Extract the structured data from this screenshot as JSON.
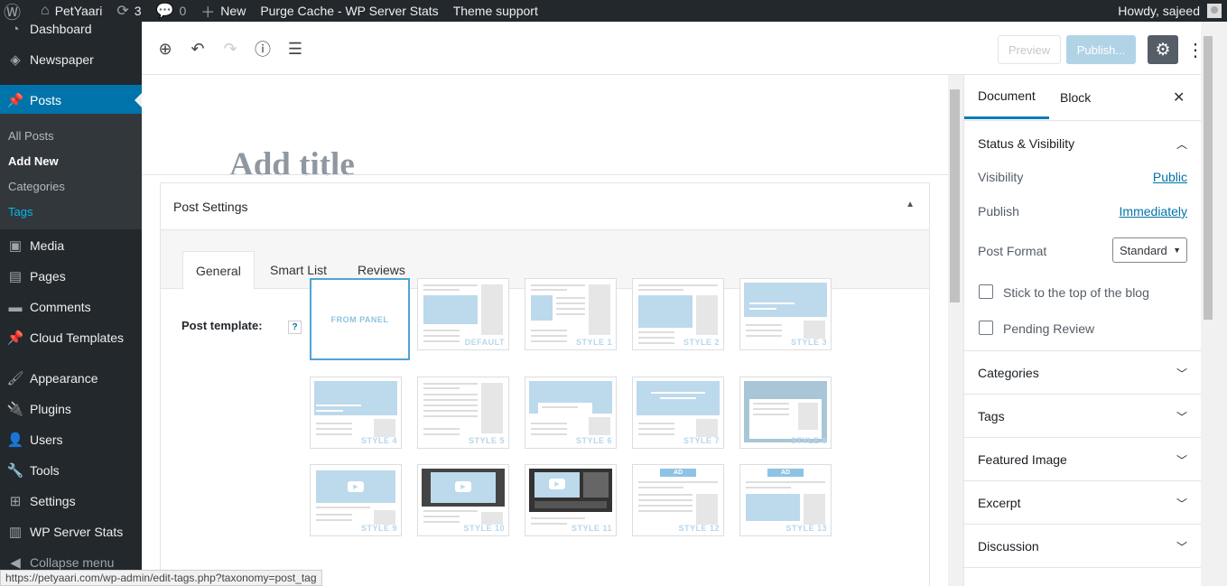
{
  "adminbar": {
    "site_name": "PetYaari",
    "updates_count": "3",
    "comments_count": "0",
    "new_label": "New",
    "purge_cache_label": "Purge Cache - WP Server Stats",
    "theme_support_label": "Theme support",
    "howdy_label": "Howdy, sajeed"
  },
  "sidebar": {
    "dashboard": "Dashboard",
    "newspaper": "Newspaper",
    "posts": "Posts",
    "posts_sub": [
      "All Posts",
      "Add New",
      "Categories",
      "Tags"
    ],
    "media": "Media",
    "pages": "Pages",
    "comments": "Comments",
    "cloud_templates": "Cloud Templates",
    "appearance": "Appearance",
    "plugins": "Plugins",
    "users": "Users",
    "tools": "Tools",
    "settings": "Settings",
    "wp_server_stats": "WP Server Stats",
    "collapse": "Collapse menu"
  },
  "toolbar": {
    "preview_label": "Preview",
    "publish_label": "Publish..."
  },
  "editor": {
    "title_placeholder": "Add title"
  },
  "post_settings": {
    "heading": "Post Settings",
    "tabs": [
      "General",
      "Smart List",
      "Reviews"
    ],
    "template_label": "Post template:",
    "help_label": "?",
    "templates": [
      "FROM PANEL",
      "DEFAULT",
      "STYLE 1",
      "STYLE 2",
      "STYLE 3",
      "STYLE 4",
      "STYLE 5",
      "STYLE 6",
      "STYLE 7",
      "STYLE 8",
      "STYLE 9",
      "STYLE 10",
      "STYLE 11",
      "STYLE 12",
      "STYLE 13"
    ],
    "ad_label": "AD"
  },
  "panel": {
    "tab_document": "Document",
    "tab_block": "Block",
    "status_title": "Status & Visibility",
    "visibility_label": "Visibility",
    "visibility_value": "Public",
    "publish_label": "Publish",
    "publish_value": "Immediately",
    "post_format_label": "Post Format",
    "post_format_value": "Standard",
    "stick_label": "Stick to the top of the blog",
    "pending_label": "Pending Review",
    "sections": [
      "Categories",
      "Tags",
      "Featured Image",
      "Excerpt",
      "Discussion"
    ]
  },
  "statusbar": {
    "url": "https://petyaari.com/wp-admin/edit-tags.php?taxonomy=post_tag"
  },
  "colors": {
    "adminbar_bg": "#23282d",
    "active_menu": "#0073aa",
    "publish_btn": "#b1d3e6",
    "link": "#0073aa"
  }
}
